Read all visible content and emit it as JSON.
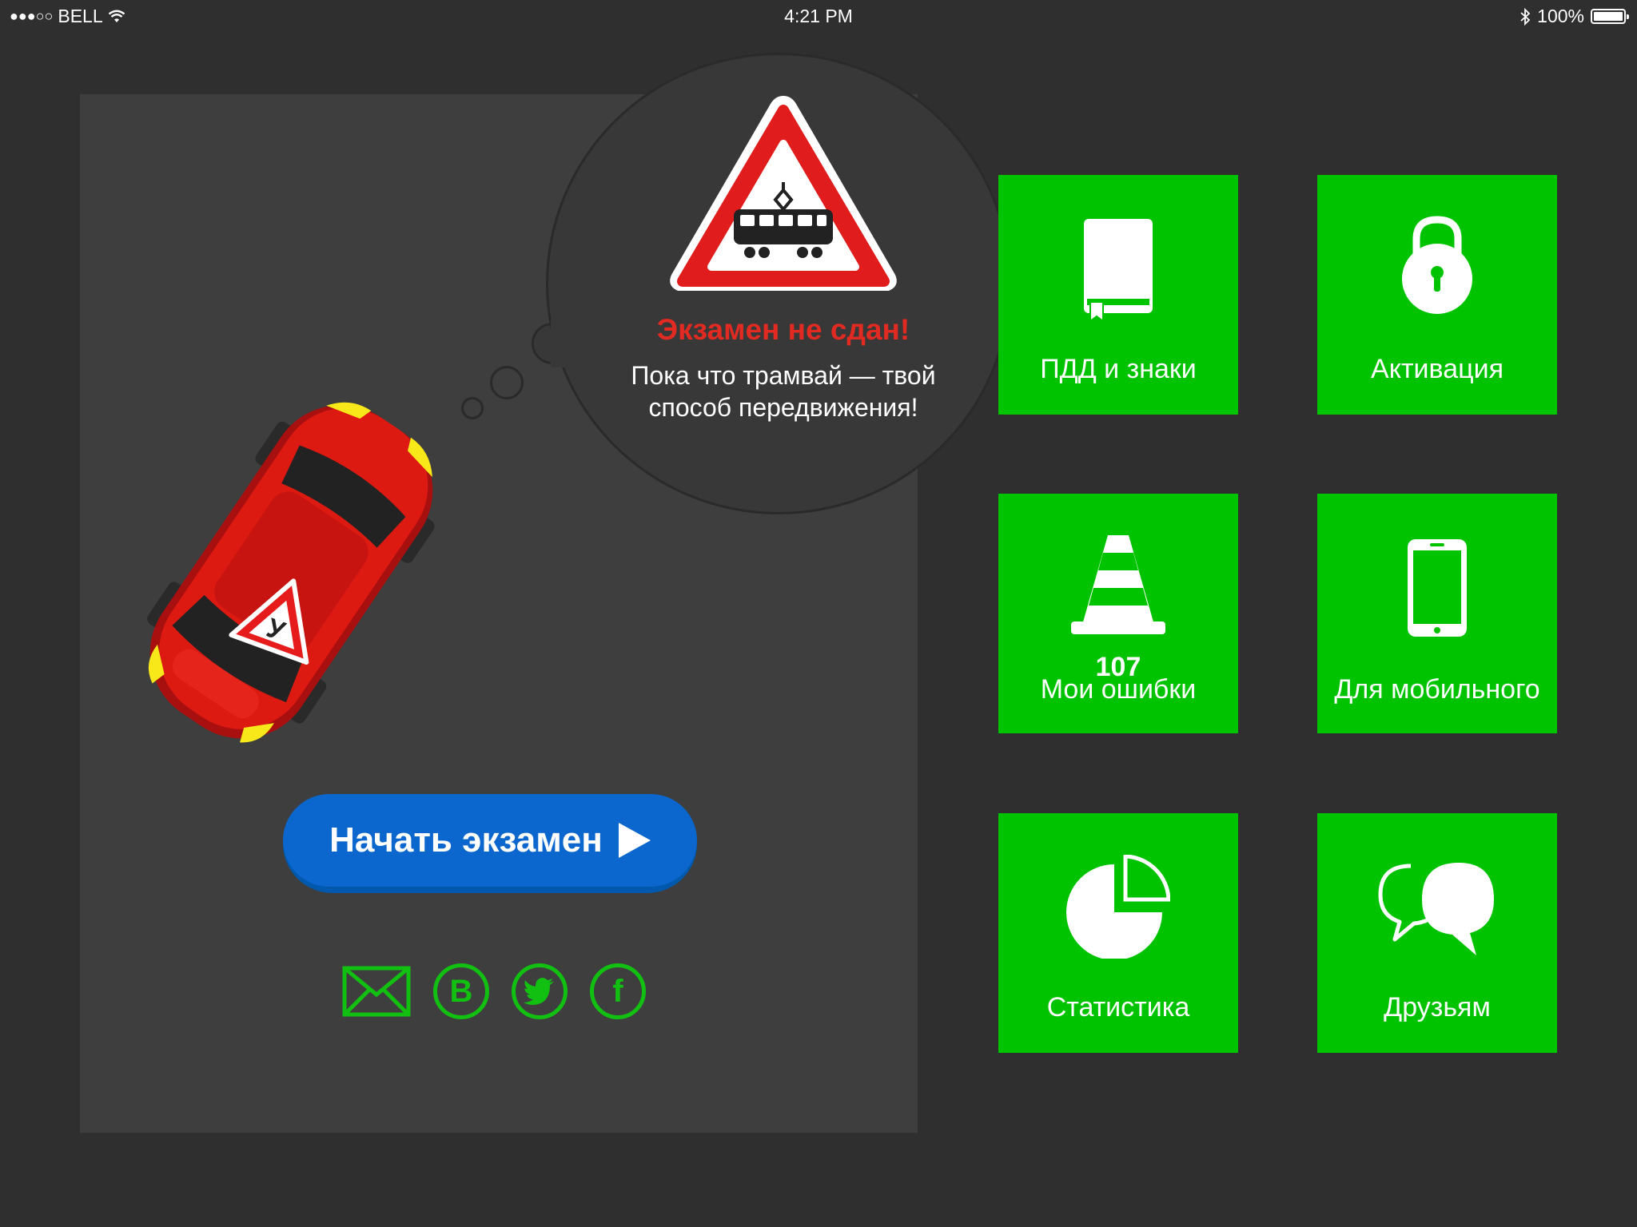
{
  "status_bar": {
    "signal": "●●●○○",
    "carrier": "BELL",
    "time": "4:21 PM",
    "battery_percent": "100%"
  },
  "result": {
    "title": "Экзамен не сдан!",
    "message_line1": "Пока что трамвай — твой",
    "message_line2": "способ передвижения!"
  },
  "car": {
    "badge_letter": "У"
  },
  "start_button": {
    "label": "Начать экзамен"
  },
  "social": {
    "vk_letter": "В",
    "facebook_letter": "f"
  },
  "tiles": [
    {
      "label": "ПДД и знаки",
      "icon": "book-icon"
    },
    {
      "label": "Активация",
      "icon": "padlock-icon"
    },
    {
      "label": "Мои ошибки",
      "icon": "traffic-cone-icon",
      "count": "107"
    },
    {
      "label": "Для мобильного",
      "icon": "smartphone-icon"
    },
    {
      "label": "Статистика",
      "icon": "pie-chart-icon"
    },
    {
      "label": "Друзьям",
      "icon": "speech-bubbles-icon"
    }
  ],
  "colors": {
    "background": "#2f2f2f",
    "panel": "#3e3e3e",
    "tile_green": "#00c300",
    "button_blue": "#0b67cd",
    "fail_red": "#e12a21",
    "social_green": "#12c012"
  }
}
